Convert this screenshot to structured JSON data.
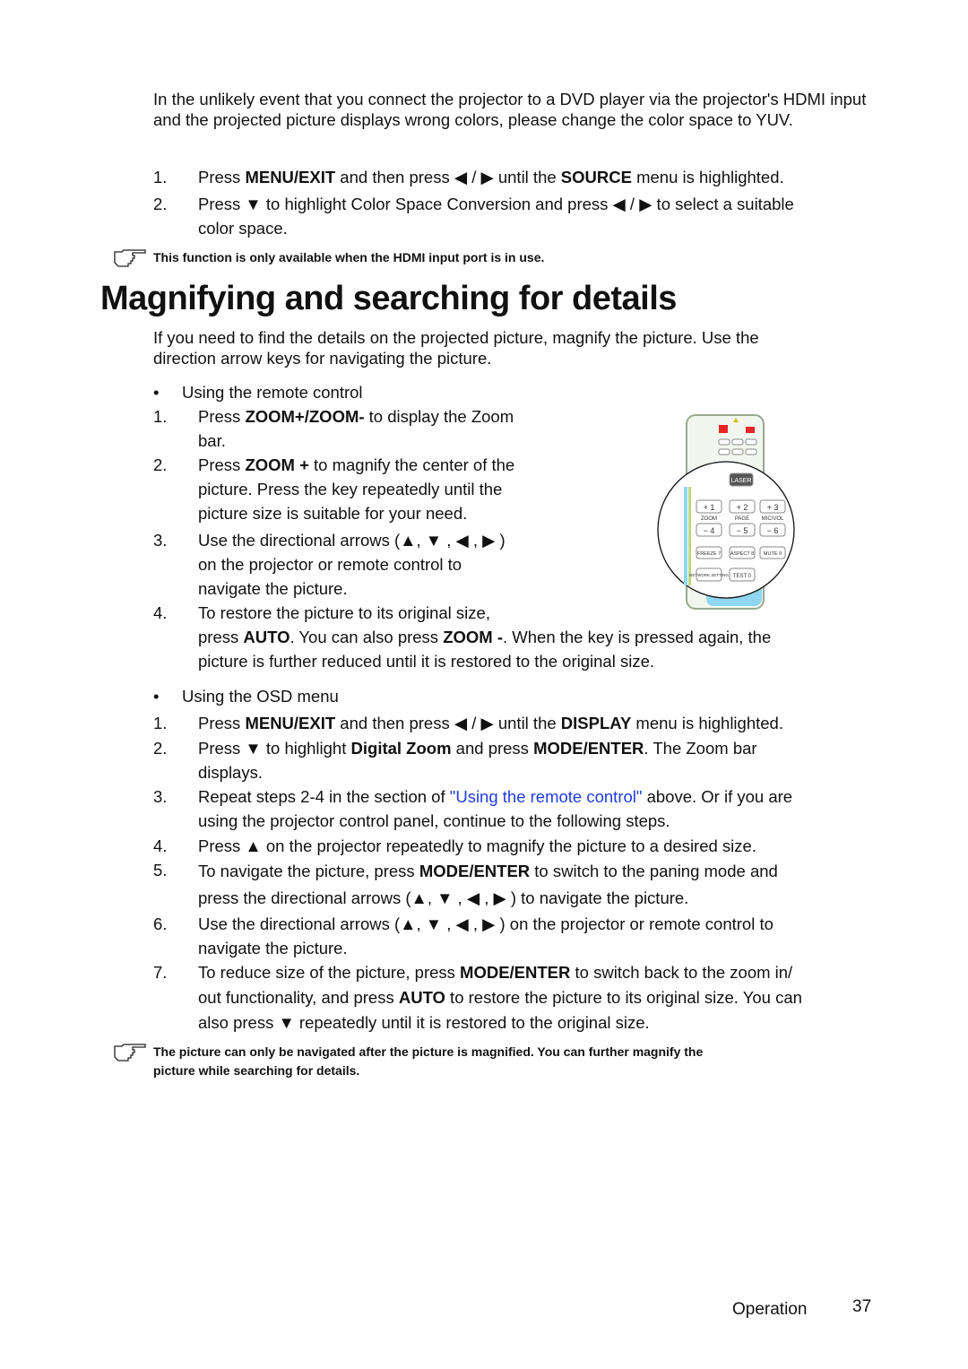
{
  "intro": {
    "paragraph": "In the unlikely event that you connect the projector to a DVD player via the projector's HDMI input and the projected picture displays wrong colors, please change the color space to YUV.",
    "steps": [
      {
        "num": "1.",
        "parts": [
          "Press ",
          "MENU/EXIT",
          " and then press  ◀ / ▶  until the ",
          "SOURCE",
          " menu is highlighted."
        ]
      },
      {
        "num": "2.",
        "line1": "Press ▼  to highlight Color Space Conversion and press ◀ / ▶  to select a suitable",
        "line2": "color space."
      }
    ],
    "note": "This function is only available when the HDMI input port is in use."
  },
  "section": {
    "title": "Magnifying and searching for details",
    "paragraph_l1": "If you need to find the details on the projected picture, magnify the picture. Use the",
    "paragraph_l2": "direction arrow keys for navigating the picture.",
    "remote": {
      "bullet": "Using the remote control",
      "s1_pre": "Press ",
      "s1_b": "ZOOM+/ZOOM-",
      "s1_post": " to display the Zoom",
      "s1_l2": "bar.",
      "s2_pre": "Press ",
      "s2_b": "ZOOM +",
      "s2_post": " to magnify the center of the",
      "s2_l2": "picture. Press the key repeatedly until the",
      "s2_l3": "picture size is suitable for your need.",
      "s3_l1": "Use the directional arrows (▲, ▼ , ◀ , ▶ )",
      "s3_l2": "on the projector or remote control to",
      "s3_l3": "navigate the picture.",
      "s4_l1": "To restore the picture to its original size,",
      "s4_pre": "press ",
      "s4_b1": "AUTO",
      "s4_mid": ". You can also press ",
      "s4_b2": "ZOOM -",
      "s4_post": ". When the key is pressed again, the",
      "s4_l3": "picture is further reduced until it is restored to the original size."
    },
    "osd": {
      "bullet": "Using the OSD menu",
      "s1_pre": "Press ",
      "s1_b1": "MENU/EXIT",
      "s1_mid": " and then press ◀ / ▶ until the ",
      "s1_b2": "DISPLAY",
      "s1_post": " menu is highlighted.",
      "s2_pre": "Press ▼ to highlight ",
      "s2_b1": "Digital Zoom",
      "s2_mid": " and press ",
      "s2_b2": "MODE/ENTER",
      "s2_post": ". The Zoom bar",
      "s2_l2": "displays.",
      "s3_pre": "Repeat steps 2-4 in the section of ",
      "s3_link": "\"Using the remote control\"",
      "s3_post": " above. Or if you are",
      "s3_l2": "using the projector control panel, continue to the following steps.",
      "s4": "Press ▲ on the projector repeatedly to magnify the picture to a desired size.",
      "s5_pre": "To navigate the picture, press ",
      "s5_b": "MODE/ENTER",
      "s5_post": " to switch to the paning mode and",
      "s5_l2": "press the directional arrows (▲, ▼ , ◀ , ▶ ) to navigate the picture.",
      "s6_l1": "Use the directional arrows (▲, ▼ , ◀ , ▶ ) on the projector or remote control to",
      "s6_l2": "navigate the picture.",
      "s7_pre": "To reduce size of the picture, press ",
      "s7_b": "MODE/ENTER",
      "s7_post": " to switch back to the zoom in/",
      "s7_l2_pre": "out functionality, and press ",
      "s7_l2_b": "AUTO",
      "s7_l2_post": " to restore the picture to its original size. You can",
      "s7_l3": "also press ▼  repeatedly until it is restored to the original size."
    },
    "note_l1": "The picture can only be navigated after the picture is magnified. You can further magnify the",
    "note_l2": "picture while searching for details."
  },
  "remote_image": {
    "buttons": [
      "LASER",
      "+ 1",
      "+ 2",
      "+ 3",
      "ZOOM",
      "PAGE",
      "MIC/VOL",
      "− 4",
      "− 5",
      "− 6",
      "FREEZE 7",
      "ASPECT 8",
      "MUTE 9",
      "NETWORK SETTING",
      "TEST 0"
    ]
  },
  "footer": {
    "section": "Operation",
    "page": "37"
  },
  "nums": [
    "1.",
    "2.",
    "3.",
    "4.",
    "5.",
    "6.",
    "7."
  ],
  "bullet_char": "•",
  "link_color": "#1f3ce0"
}
